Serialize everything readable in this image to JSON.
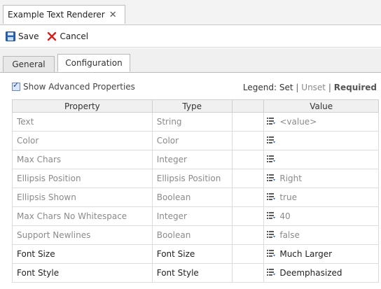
{
  "editor_tab": {
    "title": "Example Text Renderer",
    "close": "✕"
  },
  "toolbar": {
    "save_label": "Save",
    "cancel_label": "Cancel"
  },
  "subtabs": [
    {
      "label": "General"
    },
    {
      "label": "Configuration"
    }
  ],
  "advanced": {
    "label": "Show Advanced Properties",
    "checked": true
  },
  "legend": {
    "prefix": "Legend:",
    "set": "Set",
    "separator": "|",
    "unset": "Unset",
    "required": "Required"
  },
  "table": {
    "headers": [
      "Property",
      "Type",
      "",
      "Value"
    ],
    "rows": [
      {
        "property": "Text",
        "type": "String",
        "value": "<value>",
        "state": "unset"
      },
      {
        "property": "Color",
        "type": "Color",
        "value": "",
        "state": "unset"
      },
      {
        "property": "Max Chars",
        "type": "Integer",
        "value": "",
        "state": "unset"
      },
      {
        "property": "Ellipsis Position",
        "type": "Ellipsis Position",
        "value": "Right",
        "state": "unset"
      },
      {
        "property": "Ellipsis Shown",
        "type": "Boolean",
        "value": "true",
        "state": "unset"
      },
      {
        "property": "Max Chars No Whitespace",
        "type": "Integer",
        "value": "40",
        "state": "unset"
      },
      {
        "property": "Support Newlines",
        "type": "Boolean",
        "value": "false",
        "state": "unset"
      },
      {
        "property": "Font Size",
        "type": "Font Size",
        "value": "Much Larger",
        "state": "set"
      },
      {
        "property": "Font Style",
        "type": "Font Style",
        "value": "Deemphasized",
        "state": "set"
      }
    ]
  },
  "colors": {
    "accent_blue": "#2a64b4",
    "cancel_red": "#d61f1f",
    "unset_text": "#8a8a8a"
  }
}
